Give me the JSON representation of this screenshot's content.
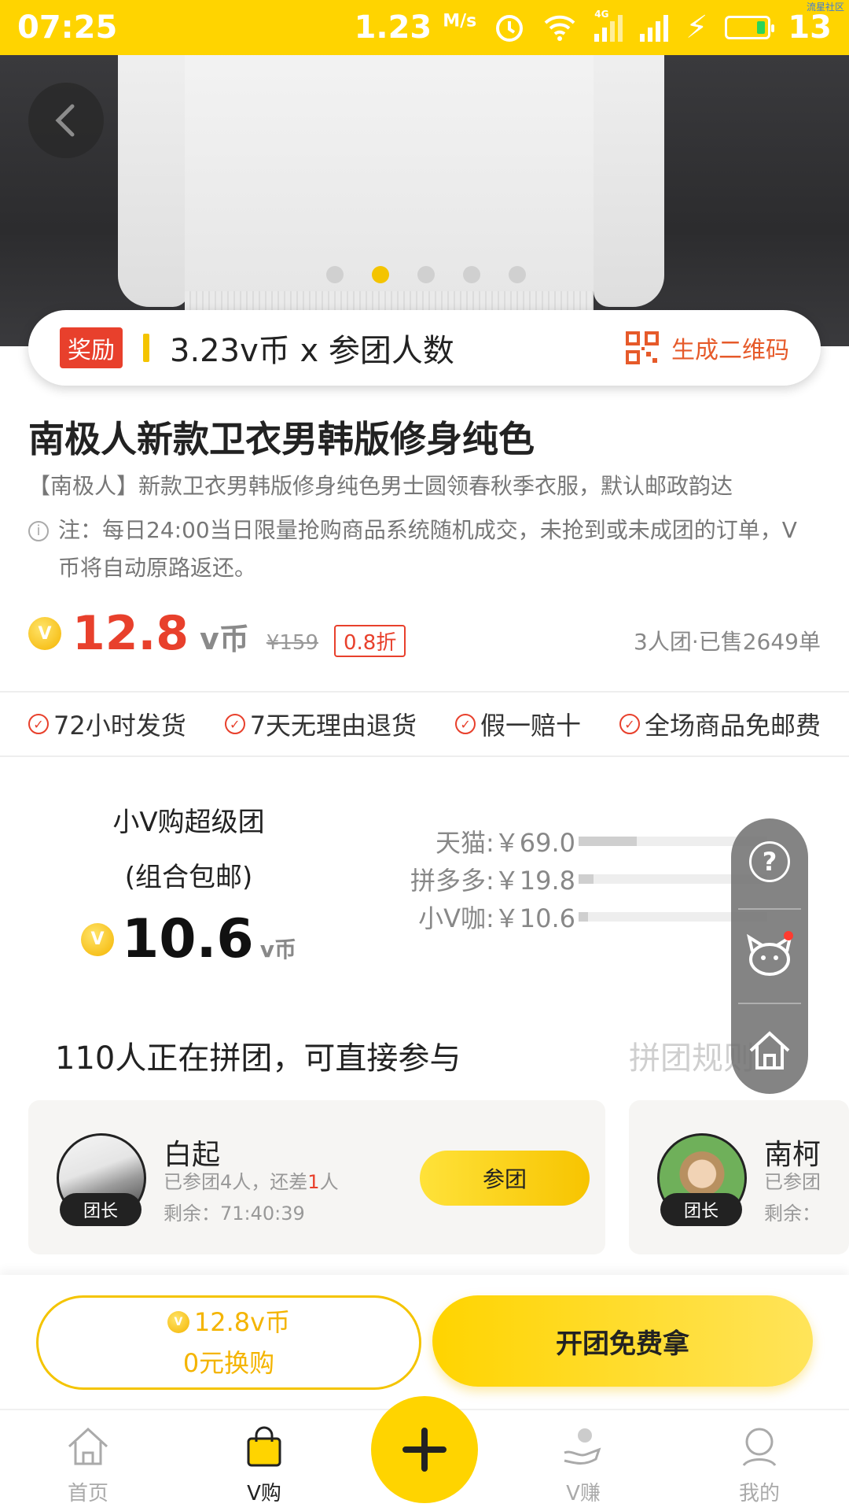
{
  "status_bar": {
    "time": "07:25",
    "speed": "1.23",
    "speed_unit": "M/s",
    "network": "4G",
    "battery_level": "13",
    "watermark": "流星社区",
    "accent": "#ffd400"
  },
  "hero": {
    "image": "white hoodie",
    "total_slides": 5,
    "active_slide": 2
  },
  "reward": {
    "badge": "奖励",
    "text": "3.23v币 x 参团人数",
    "qr_label": "生成二维码"
  },
  "product": {
    "title": "南极人新款卫衣男韩版修身纯色",
    "subtitle": "【南极人】新款卫衣男韩版修身纯色男士圆领春秋季衣服，默认邮政韵达",
    "note": "注：每日24:00当日限量抢购商品系统随机成交，未抢到或未成团的订单，V币将自动原路返还。"
  },
  "price": {
    "current": "12.8",
    "unit": "v币",
    "original": "¥159",
    "discount": "0.8折",
    "sold": "3人团·已售2649单"
  },
  "guarantees": [
    "72小时发货",
    "7天无理由退货",
    "假一赔十",
    "全场商品免邮费"
  ],
  "super_group": {
    "title_line1": "小V购超级团",
    "title_line2": "(组合包邮)",
    "price": "10.6",
    "unit": "v币"
  },
  "compare": [
    {
      "label": "天猫:￥69.0",
      "ratio": 0.31
    },
    {
      "label": "拼多多:￥19.8",
      "ratio": 0.08
    },
    {
      "label": "小V咖:￥10.6",
      "ratio": 0.05
    }
  ],
  "groups": {
    "header": "110人正在拼团，可直接参与",
    "rule_link": "拼团规则",
    "items": [
      {
        "name": "白起",
        "info_prefix": "已参团4人，还差",
        "missing": "1",
        "info_suffix": "人",
        "remaining": "剩余：71:40:39",
        "leader_tag": "团长",
        "join_label": "参团"
      },
      {
        "name": "南柯",
        "info_prefix": "已参团",
        "remaining": "剩余：",
        "leader_tag": "团长"
      }
    ]
  },
  "actions": {
    "exchange_price": "12.8v币",
    "exchange_label": "0元换购",
    "free_label": "开团免费拿"
  },
  "tabs": [
    {
      "label": "首页",
      "icon": "home-icon"
    },
    {
      "label": "V购",
      "icon": "shopping-bag-icon",
      "active": true
    },
    {
      "label": "",
      "icon": "plus-icon"
    },
    {
      "label": "V赚",
      "icon": "earn-icon"
    },
    {
      "label": "我的",
      "icon": "profile-icon"
    }
  ]
}
